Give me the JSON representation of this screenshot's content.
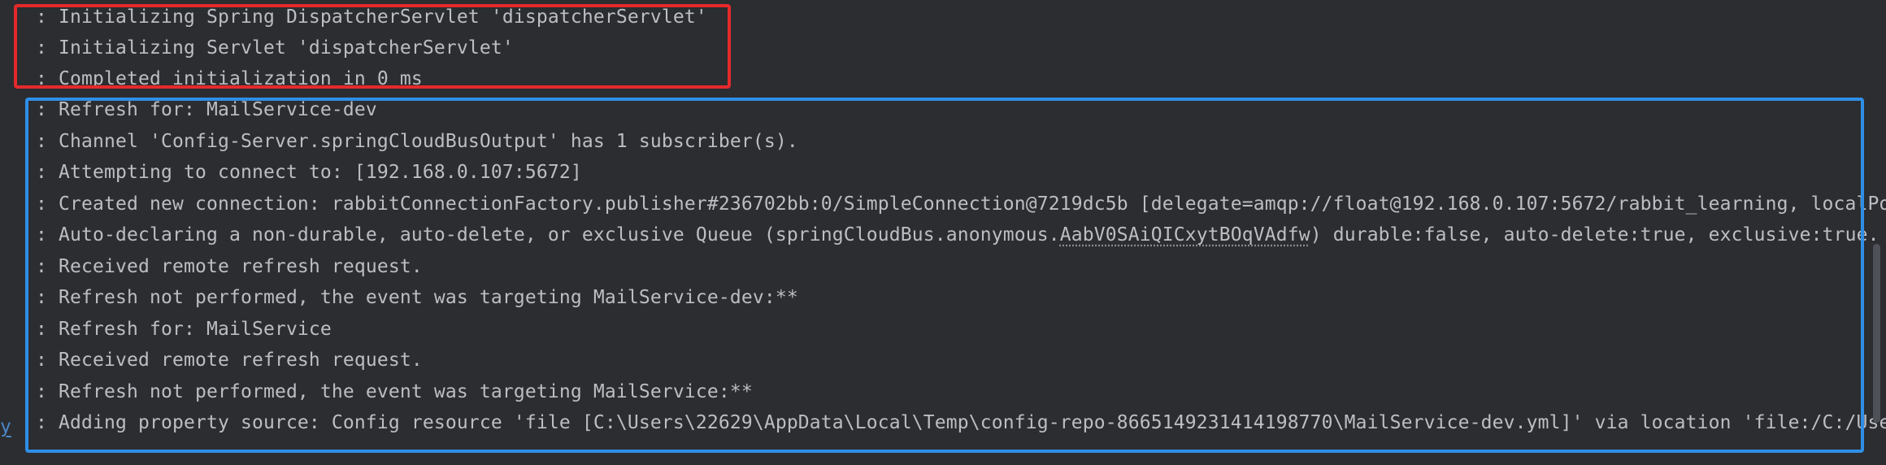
{
  "log_lines": [
    ": Initializing Spring DispatcherServlet 'dispatcherServlet'",
    ": Initializing Servlet 'dispatcherServlet'",
    ": Completed initialization in 0 ms",
    ": Refresh for: MailService-dev",
    ": Channel 'Config-Server.springCloudBusOutput' has 1 subscriber(s).",
    ": Attempting to connect to: [192.168.0.107:5672]",
    ": Created new connection: rabbitConnectionFactory.publisher#236702bb:0/SimpleConnection@7219dc5b [delegate=amqp://float@192.168.0.107:5672/rabbit_learning, localPo",
    {
      "before": ": Auto-declaring a non-durable, auto-delete, or exclusive Queue (springCloudBus.anonymous.",
      "queue_id": "AabV0SAiQICxytBOqVAdfw",
      "after": ") durable:false, auto-delete:true, exclusive:true."
    },
    ": Received remote refresh request.",
    ": Refresh not performed, the event was targeting MailService-dev:**",
    ": Refresh for: MailService",
    ": Received remote refresh request.",
    ": Refresh not performed, the event was targeting MailService:**",
    ": Adding property source: Config resource 'file [C:\\Users\\22629\\AppData\\Local\\Temp\\config-repo-8665149231414198770\\MailService-dev.yml]' via location 'file:/C:/Use"
  ],
  "left_fragment": "y",
  "highlights": {
    "red_box_color": "#e5292b",
    "blue_box_color": "#2f8fe8"
  },
  "colors": {
    "background": "#2b2d30",
    "text": "#bcbec4",
    "link": "#4a88c7"
  }
}
